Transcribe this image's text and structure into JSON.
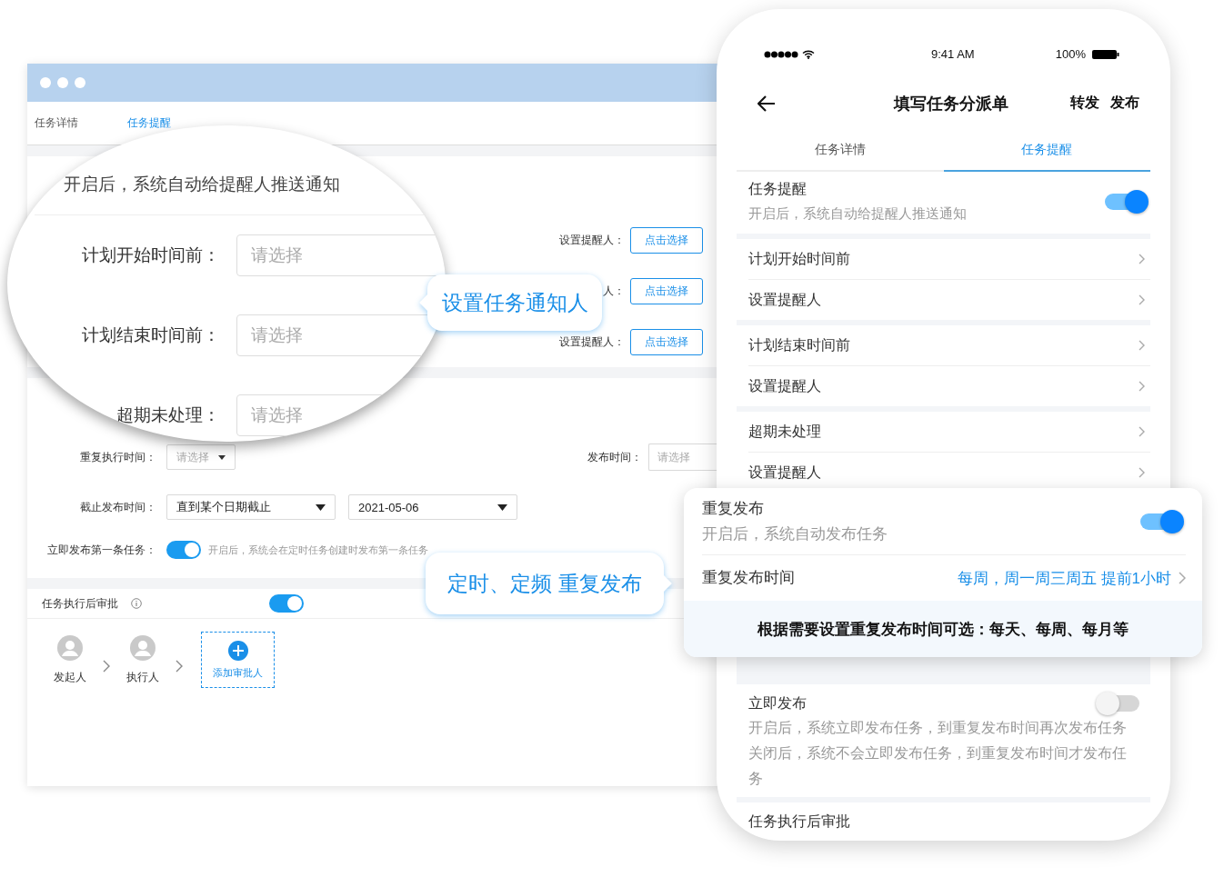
{
  "desktop_window": {
    "tabs": [
      {
        "label": "任务详情",
        "selected": false
      },
      {
        "label": "任务提醒",
        "selected": true
      }
    ],
    "reminder_assignees": [
      {
        "label": "设置提醒人：",
        "button": "点击选择"
      },
      {
        "label": "人：",
        "button": "点击选择"
      },
      {
        "label": "设置提醒人：",
        "button": "点击选择"
      }
    ],
    "repeat_time": {
      "label": "重复执行时间：",
      "placeholder": "请选择"
    },
    "publish_time": {
      "label": "发布时间：",
      "placeholder": "请选择"
    },
    "deadline": {
      "label": "截止发布时间：",
      "mode": "直到某个日期截止",
      "date": "2021-05-06"
    },
    "publish_first": {
      "label": "立即发布第一条任务：",
      "on": true,
      "hint": "开启后，系统会在定时任务创建时发布第一条任务"
    },
    "approval": {
      "label": "任务执行后审批",
      "on": true,
      "steps": [
        {
          "label": "发起人"
        },
        {
          "label": "执行人"
        }
      ],
      "add_label": "添加审批人"
    }
  },
  "magnifier": {
    "description": "开启后，系统自动给提醒人推送通知",
    "fields": [
      {
        "label": "计划开始时间前：",
        "placeholder": "请选择"
      },
      {
        "label": "计划结束时间前：",
        "placeholder": "请选择"
      },
      {
        "label": "超期未处理：",
        "placeholder": "请选择"
      }
    ]
  },
  "callouts": [
    "设置任务通知人",
    "定时、定频 重复发布"
  ],
  "phone": {
    "time": "9:41 AM",
    "battery": "100%",
    "title": "填写任务分派单",
    "actions": [
      "转发",
      "发布"
    ],
    "tabs": [
      {
        "label": "任务详情",
        "selected": false
      },
      {
        "label": "任务提醒",
        "selected": true
      }
    ],
    "sections": [
      {
        "kind": "toggle",
        "title": "任务提醒",
        "on": true,
        "description": [
          "开启后，系统自动给提醒人推送通知"
        ]
      },
      {
        "kind": "links",
        "items": [
          "计划开始时间前",
          "设置提醒人"
        ]
      },
      {
        "kind": "links",
        "items": [
          "计划结束时间前",
          "设置提醒人"
        ]
      },
      {
        "kind": "links",
        "items": [
          "超期未处理",
          "设置提醒人"
        ]
      }
    ],
    "lower_sections": [
      {
        "kind": "toggle",
        "title": "立即发布",
        "on": false,
        "description": [
          "开启后，系统立即发布任务，到重复发布时间再次发布任务",
          "关闭后，系统不会立即发布任务，到重复发布时间才发布任务"
        ]
      },
      {
        "kind": "header",
        "title": "任务执行后审批"
      }
    ]
  },
  "popup": {
    "title": "重复发布",
    "description": "开启后，系统自动发布任务",
    "on": true,
    "row_label": "重复发布时间",
    "row_value": "每周，周一周三周五 提前1小时",
    "note": "根据需要设置重复发布时间可选：每天、每周、每月等"
  }
}
